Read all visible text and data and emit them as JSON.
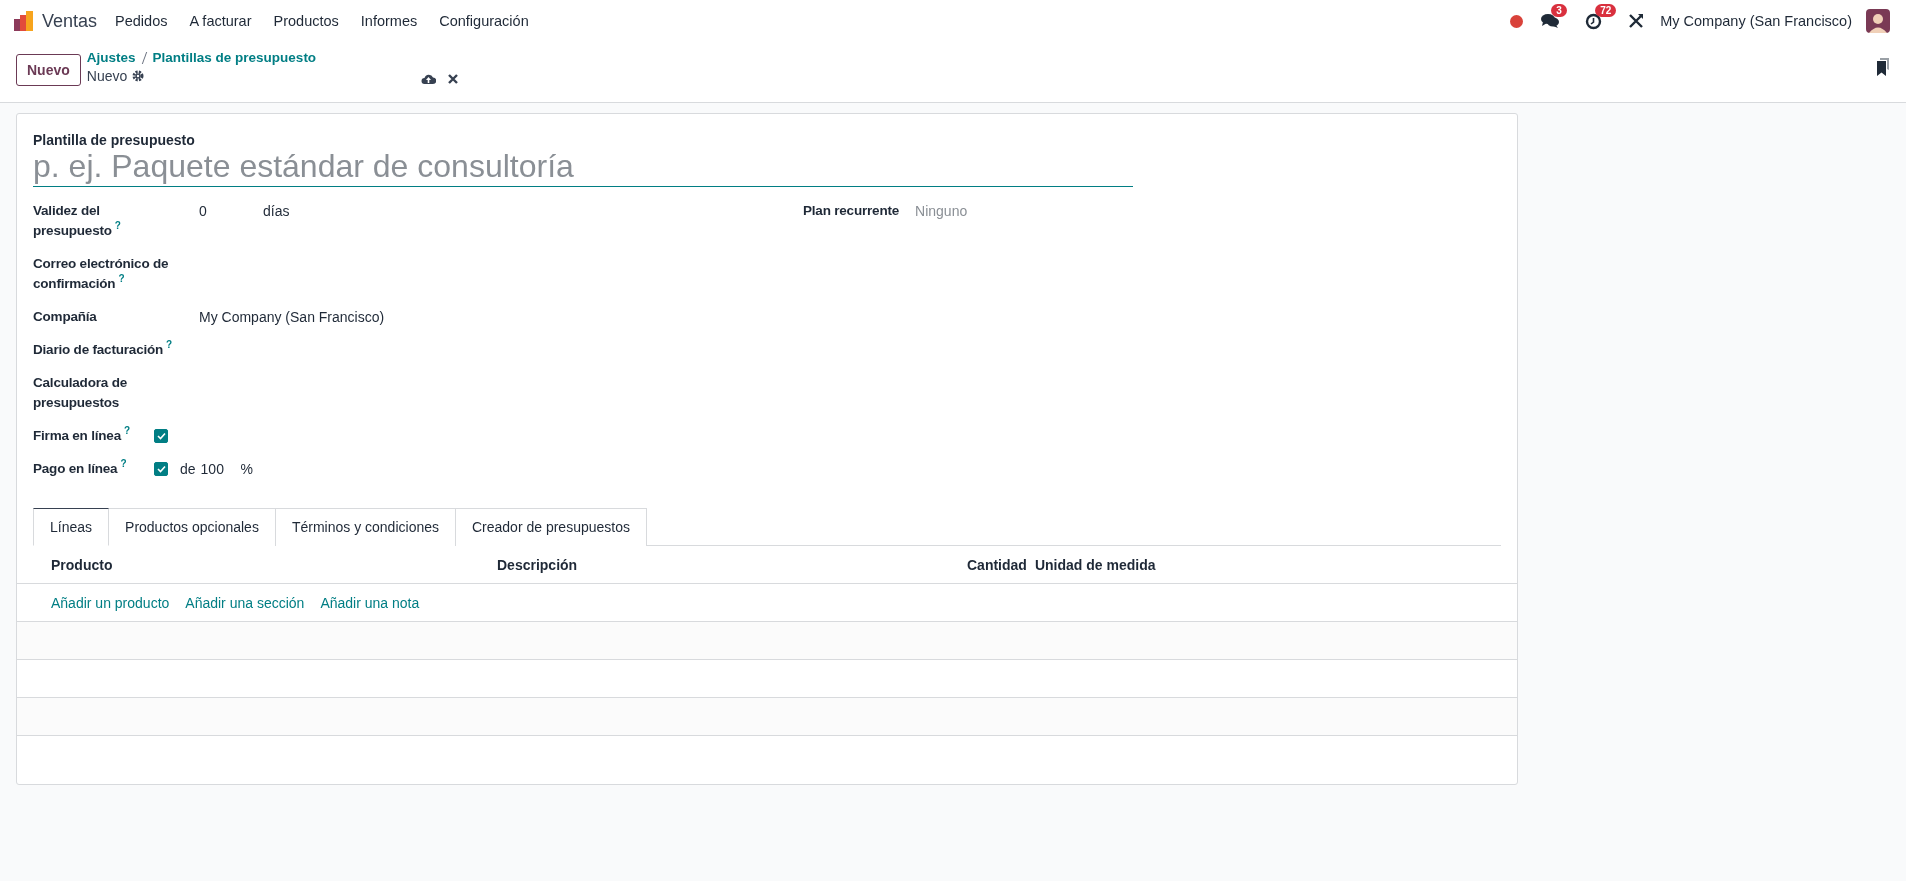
{
  "navbar": {
    "app": "Ventas",
    "menu": [
      "Pedidos",
      "A facturar",
      "Productos",
      "Informes",
      "Configuración"
    ],
    "messages_badge": "3",
    "activities_badge": "72",
    "company": "My Company (San Francisco)"
  },
  "control_panel": {
    "new_button": "Nuevo",
    "breadcrumbs": [
      "Ajustes",
      "Plantillas de presupuesto"
    ],
    "record": "Nuevo"
  },
  "form": {
    "title_label": "Plantilla de presupuesto",
    "title_placeholder": "p. ej. Paquete estándar de consultoría",
    "fields": [
      {
        "kind": "number_unit",
        "label": "Validez del presupuesto",
        "help": "?",
        "value": "0",
        "unit": "días"
      },
      {
        "kind": "empty",
        "label": "Correo electrónico de confirmación",
        "help": "?"
      },
      {
        "kind": "text",
        "label": "Compañía",
        "value": "My Company (San Francisco)"
      },
      {
        "kind": "empty",
        "label": "Diario de facturación",
        "help": "?"
      },
      {
        "kind": "empty",
        "label": "Calculadora de presupuestos"
      },
      {
        "kind": "checkbox",
        "label": "Firma en línea",
        "help": "?",
        "checked": true
      },
      {
        "kind": "checkbox_percent",
        "label": "Pago en línea",
        "help": "?",
        "checked": true,
        "prefix": "de",
        "value": "100",
        "unit": "%"
      }
    ],
    "right_fields": [
      {
        "label": "Plan recurrente",
        "placeholder": "Ninguno"
      }
    ],
    "tabs": [
      {
        "label": "Líneas",
        "selected": true
      },
      {
        "label": "Productos opcionales",
        "selected": false
      },
      {
        "label": "Términos y condiciones",
        "selected": false
      },
      {
        "label": "Creador de presupuestos",
        "selected": false
      }
    ],
    "table": {
      "columns": [
        "Producto",
        "Descripción",
        "Cantidad",
        "Unidad de medida"
      ],
      "add_links": [
        "Añadir un producto",
        "Añadir una sección",
        "Añadir una nota"
      ]
    }
  }
}
